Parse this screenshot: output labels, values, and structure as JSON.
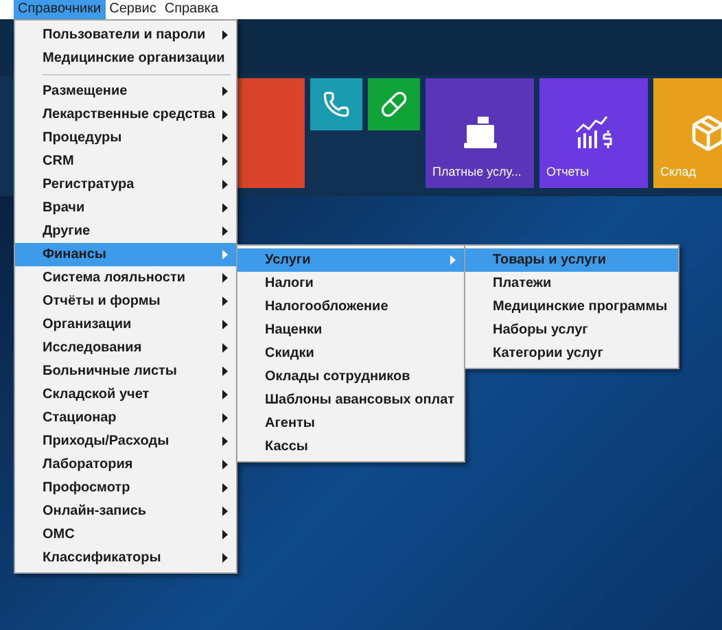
{
  "menubar": [
    {
      "label": "Справочники",
      "selected": true
    },
    {
      "label": "Сервис",
      "selected": false
    },
    {
      "label": "Справка",
      "selected": false
    }
  ],
  "tiles": [
    {
      "kind": "blank",
      "color": "#d9452a"
    },
    {
      "kind": "phone",
      "color": "#1a9bb0"
    },
    {
      "kind": "pill",
      "color": "#10a338"
    },
    {
      "kind": "register",
      "color": "#5a35b8",
      "label": "Платные услу..."
    },
    {
      "kind": "chart",
      "color": "#6a3ae0",
      "label": "Отчеты"
    },
    {
      "kind": "box",
      "color": "#e8a01c",
      "label": "Склад"
    }
  ],
  "menu": [
    {
      "kind": "item",
      "label": "Пользователи и пароли",
      "submenu": true,
      "selected": false
    },
    {
      "kind": "item",
      "label": "Медицинские организации",
      "submenu": false,
      "selected": false
    },
    {
      "kind": "separator"
    },
    {
      "kind": "item",
      "label": "Размещение",
      "submenu": true,
      "selected": false
    },
    {
      "kind": "item",
      "label": "Лекарственные средства",
      "submenu": true,
      "selected": false
    },
    {
      "kind": "item",
      "label": "Процедуры",
      "submenu": true,
      "selected": false
    },
    {
      "kind": "item",
      "label": "CRM",
      "submenu": true,
      "selected": false
    },
    {
      "kind": "item",
      "label": "Регистратура",
      "submenu": true,
      "selected": false
    },
    {
      "kind": "item",
      "label": "Врачи",
      "submenu": true,
      "selected": false
    },
    {
      "kind": "item",
      "label": "Другие",
      "submenu": true,
      "selected": false
    },
    {
      "kind": "item",
      "label": "Финансы",
      "submenu": true,
      "selected": true
    },
    {
      "kind": "item",
      "label": "Система лояльности",
      "submenu": true,
      "selected": false
    },
    {
      "kind": "item",
      "label": "Отчёты и формы",
      "submenu": true,
      "selected": false
    },
    {
      "kind": "item",
      "label": "Организации",
      "submenu": true,
      "selected": false
    },
    {
      "kind": "item",
      "label": "Исследования",
      "submenu": true,
      "selected": false
    },
    {
      "kind": "item",
      "label": "Больничные листы",
      "submenu": true,
      "selected": false
    },
    {
      "kind": "item",
      "label": "Складской учет",
      "submenu": true,
      "selected": false
    },
    {
      "kind": "item",
      "label": "Стационар",
      "submenu": true,
      "selected": false
    },
    {
      "kind": "item",
      "label": "Приходы/Расходы",
      "submenu": true,
      "selected": false
    },
    {
      "kind": "item",
      "label": "Лаборатория",
      "submenu": true,
      "selected": false
    },
    {
      "kind": "item",
      "label": "Профосмотр",
      "submenu": true,
      "selected": false
    },
    {
      "kind": "item",
      "label": "Онлайн-запись",
      "submenu": true,
      "selected": false
    },
    {
      "kind": "item",
      "label": "ОМС",
      "submenu": true,
      "selected": false
    },
    {
      "kind": "item",
      "label": "Классификаторы",
      "submenu": true,
      "selected": false
    }
  ],
  "submenu": [
    {
      "kind": "item",
      "label": "Услуги",
      "submenu": true,
      "selected": true
    },
    {
      "kind": "item",
      "label": "Налоги",
      "submenu": false,
      "selected": false
    },
    {
      "kind": "item",
      "label": "Налогообложение",
      "submenu": false,
      "selected": false
    },
    {
      "kind": "item",
      "label": "Наценки",
      "submenu": false,
      "selected": false
    },
    {
      "kind": "item",
      "label": "Скидки",
      "submenu": false,
      "selected": false
    },
    {
      "kind": "item",
      "label": "Оклады сотрудников",
      "submenu": false,
      "selected": false
    },
    {
      "kind": "item",
      "label": "Шаблоны авансовых оплат",
      "submenu": false,
      "selected": false
    },
    {
      "kind": "item",
      "label": "Агенты",
      "submenu": false,
      "selected": false
    },
    {
      "kind": "item",
      "label": "Кассы",
      "submenu": false,
      "selected": false
    }
  ],
  "submenu_2": [
    {
      "kind": "item",
      "label": "Товары и услуги",
      "submenu": false,
      "selected": true
    },
    {
      "kind": "item",
      "label": "Платежи",
      "submenu": false,
      "selected": false
    },
    {
      "kind": "item",
      "label": "Медицинские программы",
      "submenu": false,
      "selected": false
    },
    {
      "kind": "item",
      "label": "Наборы услуг",
      "submenu": false,
      "selected": false
    },
    {
      "kind": "item",
      "label": "Категории услуг",
      "submenu": false,
      "selected": false
    }
  ]
}
